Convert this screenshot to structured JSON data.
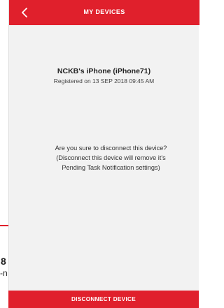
{
  "header": {
    "title": "MY DEVICES",
    "back_icon": "chevron-left-icon"
  },
  "device": {
    "name": "NCKB's iPhone (iPhone71)",
    "registered": "Registered on 13 SEP 2018 09:45 AM"
  },
  "confirm": {
    "line1": "Are you sure to disconnect this device?",
    "line2": "(Disconnect this device will remove it's",
    "line3": "Pending Task Notification settings)"
  },
  "actions": {
    "disconnect_label": "DISCONNECT DEVICE"
  },
  "background_fragments": {
    "digit": "8",
    "text": "-n"
  },
  "colors": {
    "accent": "#e0202c",
    "screen_bg": "#f2f2f2"
  }
}
